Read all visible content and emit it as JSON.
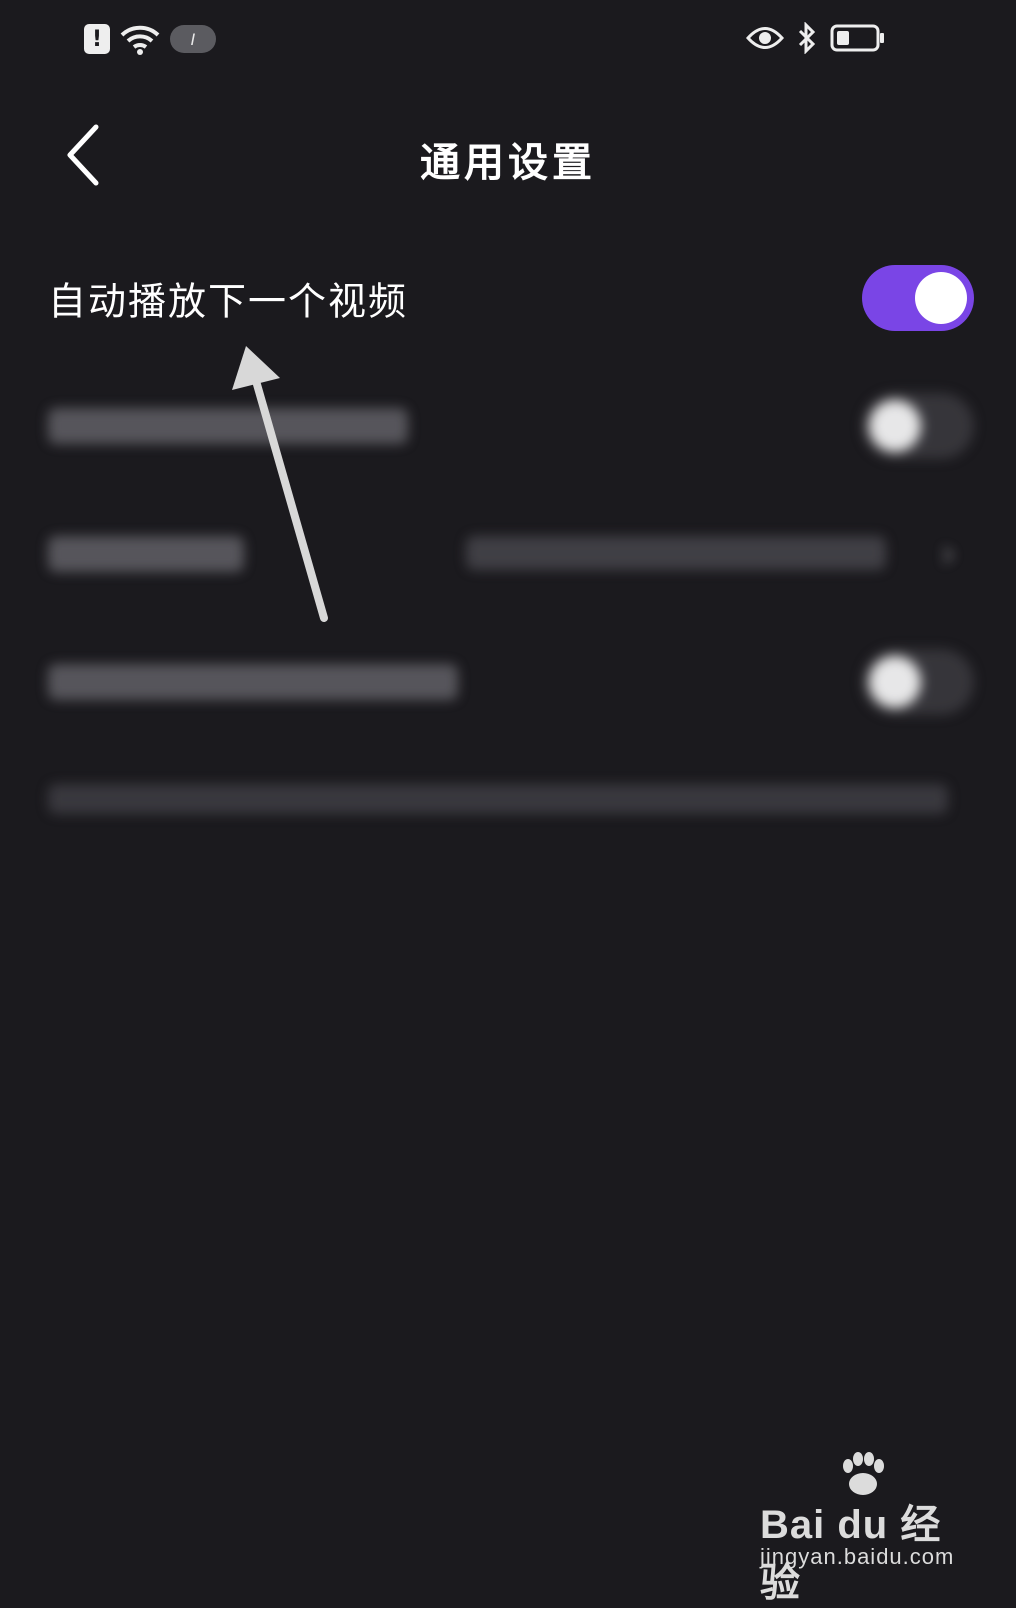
{
  "status_bar": {
    "pill_text": "I",
    "icons": [
      "alert-icon",
      "wifi-icon",
      "eye-icon",
      "bluetooth-icon",
      "battery-icon"
    ]
  },
  "header": {
    "title": "通用设置",
    "back_icon": "chevron-left-icon"
  },
  "settings": {
    "auto_play_next": {
      "label": "自动播放下一个视频",
      "enabled": true
    }
  },
  "colors": {
    "background": "#1b1a1e",
    "toggle_on": "#7a45e6",
    "annotation": "#d8d8d8"
  },
  "watermark": {
    "logo": "Bai du 经验",
    "url": "jingyan.baidu.com"
  }
}
